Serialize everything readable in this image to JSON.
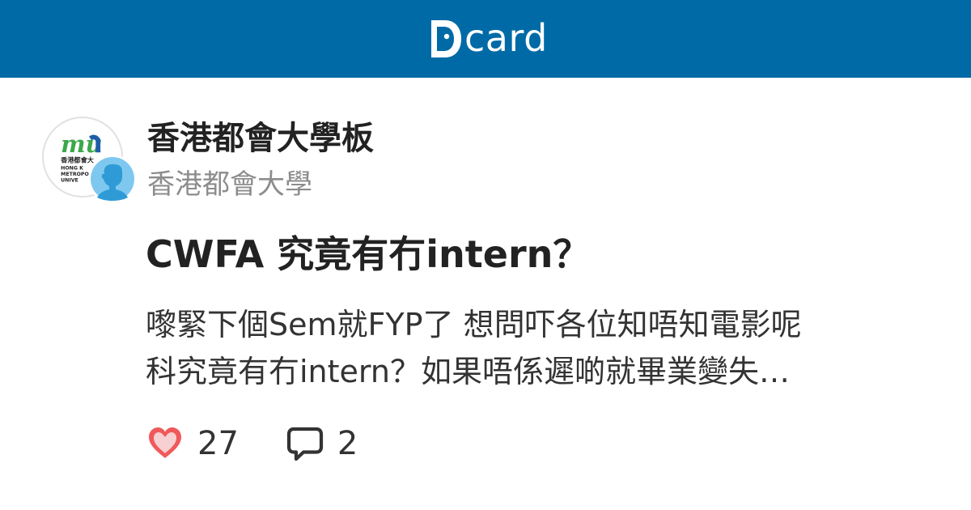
{
  "header": {
    "logo_text": "card",
    "bar_color": "#006aa6"
  },
  "board": {
    "name": "香港都會大學板",
    "school": "香港都會大學",
    "logo_icon": "hkmu-logo-icon",
    "logo_letters": "mu",
    "logo_caption": [
      "香港都會大",
      "HONG K",
      "METROPO",
      "UNIVE"
    ]
  },
  "author": {
    "avatar_icon": "anonymous-male-avatar-icon",
    "avatar_color": "#7ec8f0"
  },
  "post": {
    "title": "CWFA 究竟有冇intern？",
    "excerpt_lines": [
      "嚟緊下個Sem就FYP了 想問吓各位知唔知電影呢",
      "科究竟有冇intern？如果唔係遲啲就畢業變失…"
    ]
  },
  "stats": {
    "likes": "27",
    "comments": "2",
    "like_icon": "heart-icon",
    "like_color": "#f0595b",
    "comment_icon": "comment-icon"
  }
}
